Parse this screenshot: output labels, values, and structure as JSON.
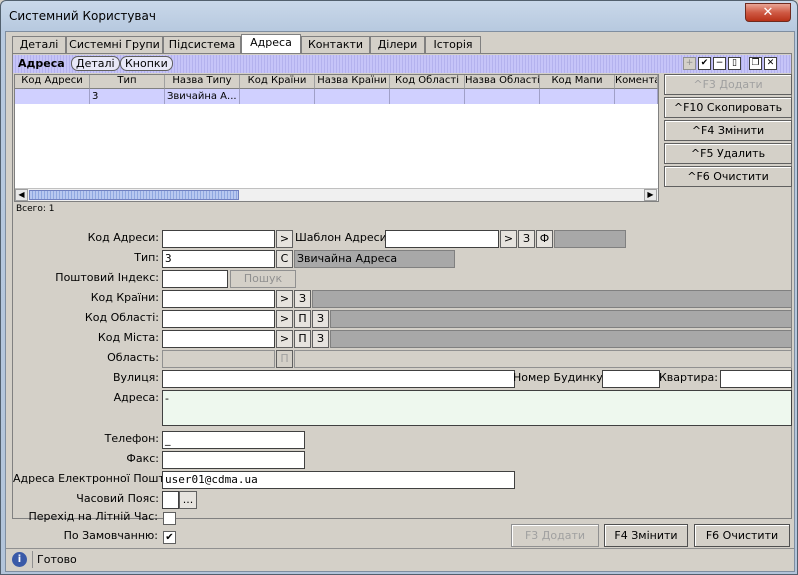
{
  "window": {
    "title": "Системний Користувач",
    "close_glyph": "✕"
  },
  "tabs": [
    "Деталі",
    "Системні Групи",
    "Підсистема",
    "Адреса",
    "Контакти",
    "Ділери",
    "Історія"
  ],
  "active_tab": "Адреса",
  "subheader": {
    "title": "Адреса",
    "tabs": [
      "Деталі",
      "Кнопки"
    ]
  },
  "grid": {
    "columns": [
      "Код Адреси",
      "Тип",
      "Назва Типу",
      "Код Країни",
      "Назва Країни",
      "Код Області",
      "Назва Області",
      "Код Мапи",
      "Комента"
    ],
    "rows": [
      [
        "",
        "3",
        "Звичайна А...",
        "",
        "",
        "",
        "",
        "",
        ""
      ]
    ],
    "total_label": "Всего: 1"
  },
  "side_buttons": [
    "^F3 Додати",
    "^F10 Скопировать",
    "^F4 Змінити",
    "^F5 Удалить",
    "^F6 Очистити"
  ],
  "form": {
    "address_code_label": "Код Адреси:",
    "address_template_label": "Шаблон Адреси:",
    "type_label": "Тип:",
    "type_value": "3",
    "type_btn": "С",
    "type_name": "Звичайна Адреса",
    "postal_label": "Поштовий Індекс:",
    "search_btn": "Пошук",
    "country_label": "Код Країни:",
    "region_label": "Код Області:",
    "city_label": "Код Міста:",
    "area_label": "Область:",
    "street_label": "Вулиця:",
    "house_label": "Номер Будинку:",
    "apt_label": "Квартира:",
    "address_label": "Адреса:",
    "address_value": "-",
    "phone_label": "Телефон:",
    "phone_value": "_",
    "fax_label": "Факс:",
    "email_label": "Адреса Електронної Пошти:",
    "email_value": "user01@cdma.ua",
    "tz_label": "Часовий Пояс:",
    "tz_btn": "...",
    "dst_label": "Перехід на Літній Час:",
    "default_label": "По Замовчанню:",
    "btn_arrow": ">",
    "btn_3": "З",
    "btn_p": "П",
    "btn_f": "Ф"
  },
  "bottom_buttons": [
    "F3 Додати",
    "F4 Змінити",
    "F6 Очистити"
  ],
  "status": {
    "icon": "i",
    "text": "Готово"
  }
}
